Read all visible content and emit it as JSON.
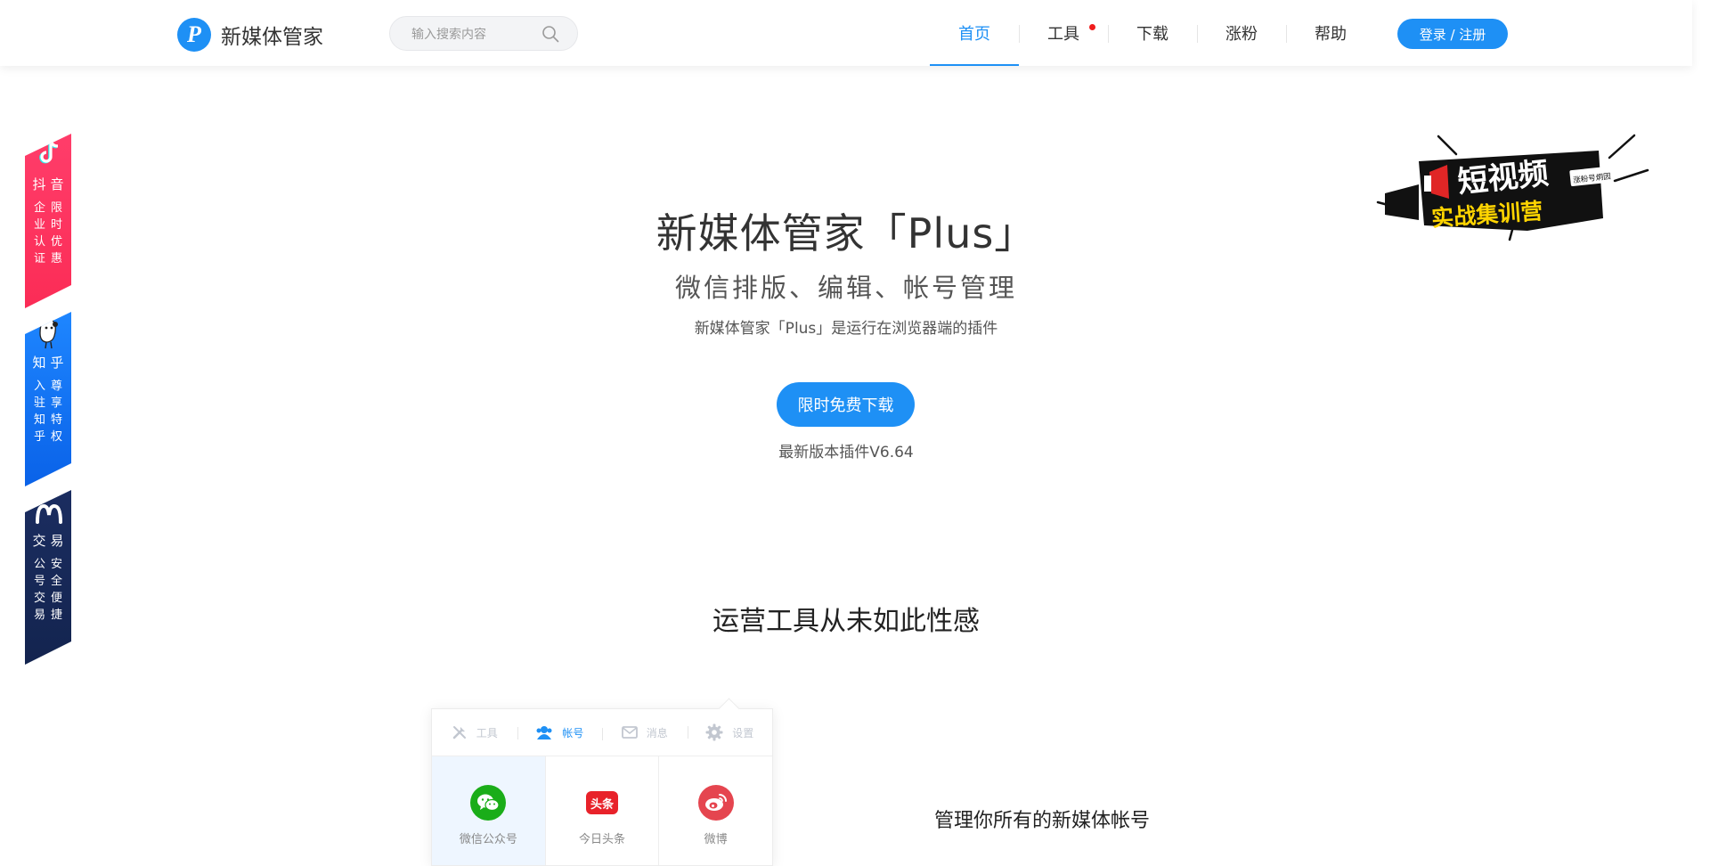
{
  "header": {
    "brand": "新媒体管家",
    "logo_letter": "P",
    "search_placeholder": "输入搜索内容",
    "nav": [
      {
        "label": "首页",
        "active": true
      },
      {
        "label": "工具",
        "badge": true
      },
      {
        "label": "下载"
      },
      {
        "label": "涨粉"
      },
      {
        "label": "帮助"
      }
    ],
    "login_label": "登录 / 注册"
  },
  "side_banners": [
    {
      "title": "抖音",
      "col1": "企业认证",
      "col2": "限时优惠",
      "color": "#fb2c56"
    },
    {
      "title": "知乎",
      "col1": "入驻知乎",
      "col2": "尊享特权",
      "color": "#0a62e8"
    },
    {
      "title": "交易",
      "col1": "公号交易",
      "col2": "安全便捷",
      "color": "#13244f"
    }
  ],
  "promo": {
    "line1": "短视频",
    "line2": "实战集训营",
    "tag": "涨粉号炯因"
  },
  "hero": {
    "title": "新媒体管家「Plus」",
    "subtitle": "微信排版、编辑、帐号管理",
    "description": "新媒体管家「Plus」是运行在浏览器端的插件",
    "download_label": "限时免费下载",
    "version": "最新版本插件V6.64"
  },
  "features": {
    "section_title": "运营工具从未如此性感",
    "panel_tabs": [
      {
        "label": "工具",
        "icon": "tools-icon"
      },
      {
        "label": "帐号",
        "icon": "users-icon",
        "active": true
      },
      {
        "label": "消息",
        "icon": "message-icon"
      },
      {
        "label": "设置",
        "icon": "gear-icon"
      }
    ],
    "accounts": [
      {
        "label": "微信公众号",
        "icon": "wechat-icon",
        "color": "#1aad19"
      },
      {
        "label": "今日头条",
        "icon": "toutiao-icon",
        "color": "#e8222a",
        "badge_text": "头条"
      },
      {
        "label": "微博",
        "icon": "weibo-icon",
        "color": "#e5454f"
      }
    ],
    "caption": "管理你所有的新媒体帐号"
  },
  "colors": {
    "accent": "#1e90f5",
    "badge_red": "#f01c1c"
  }
}
